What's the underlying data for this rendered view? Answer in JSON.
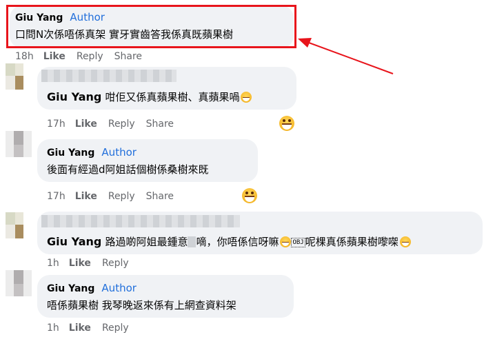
{
  "comments": [
    {
      "name": "Giu Yang",
      "author_badge": "Author",
      "text": "口問N次係唔係真架 實牙實齒答我係真既蘋果樹",
      "time": "18h",
      "like": "Like",
      "reply": "Reply",
      "share": "Share"
    },
    {
      "name": "Giu Yang",
      "text": "咁佢又係真蘋果樹、真蘋果喎",
      "time": "17h",
      "like": "Like",
      "reply": "Reply",
      "share": "Share"
    },
    {
      "name": "Giu Yang",
      "author_badge": "Author",
      "text": "後面有經過d阿姐話個樹係桑樹來既",
      "time": "17h",
      "like": "Like",
      "reply": "Reply",
      "share": "Share"
    },
    {
      "name": "Giu Yang",
      "text_part1": "路過啲阿姐最鍾意",
      "text_part2": "嘀，你唔係信呀嘛",
      "obj": "OBJ",
      "text_part3": "呢棵真係蘋果樹嚟㗎",
      "time": "1h",
      "like": "Like",
      "reply": "Reply"
    },
    {
      "name": "Giu Yang",
      "author_badge": "Author",
      "text": "唔係蘋果樹 我琴晚返來係有上網查資料架",
      "time": "1h",
      "like": "Like",
      "reply": "Reply"
    }
  ],
  "colors": {
    "bubble": "#f0f2f5",
    "author_blue": "#216fdb",
    "action_gray": "#65676b",
    "highlight_red": "#e8141b"
  },
  "icons": [
    "grinning-emoji-icon",
    "red-arrow-annotation",
    "avatar-image"
  ]
}
